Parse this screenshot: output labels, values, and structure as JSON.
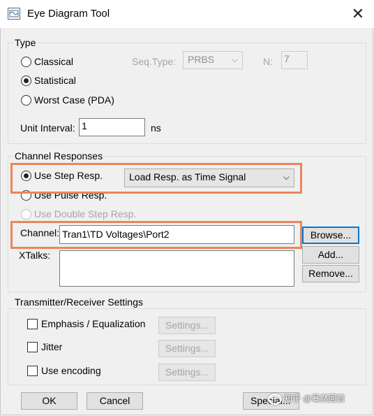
{
  "window": {
    "title": "Eye Diagram Tool",
    "close": "✕"
  },
  "type_group": {
    "label": "Type",
    "classical": "Classical",
    "statistical": "Statistical",
    "worst_case": "Worst Case (PDA)",
    "selected": "statistical",
    "seq_type_label": "Seq.Type:",
    "seq_type_value": "PRBS",
    "n_label": "N:",
    "n_value": "7",
    "unit_interval_label": "Unit Interval:",
    "unit_interval_value": "1",
    "unit": "ns"
  },
  "channel_group": {
    "label": "Channel Responses",
    "use_step": "Use Step Resp.",
    "use_pulse": "Use Pulse Resp.",
    "use_double_step": "Use Double Step Resp.",
    "selected": "use_step",
    "load_resp_value": "Load Resp. as Time Signal",
    "channel_label": "Channel:",
    "channel_value": "Tran1\\TD Voltages\\Port2",
    "xtalks_label": "XTalks:",
    "browse": "Browse...",
    "add": "Add...",
    "remove": "Remove..."
  },
  "txrx_group": {
    "label": "Transmitter/Receiver Settings",
    "emphasis": "Emphasis / Equalization",
    "jitter": "Jitter",
    "encoding": "Use encoding",
    "settings": "Settings..."
  },
  "footer": {
    "ok": "OK",
    "cancel": "Cancel",
    "special": "Special...",
    "watermark": "知乎 @蓦然回首"
  },
  "colors": {
    "highlight": "#e8875a",
    "focus": "#0078d7"
  }
}
